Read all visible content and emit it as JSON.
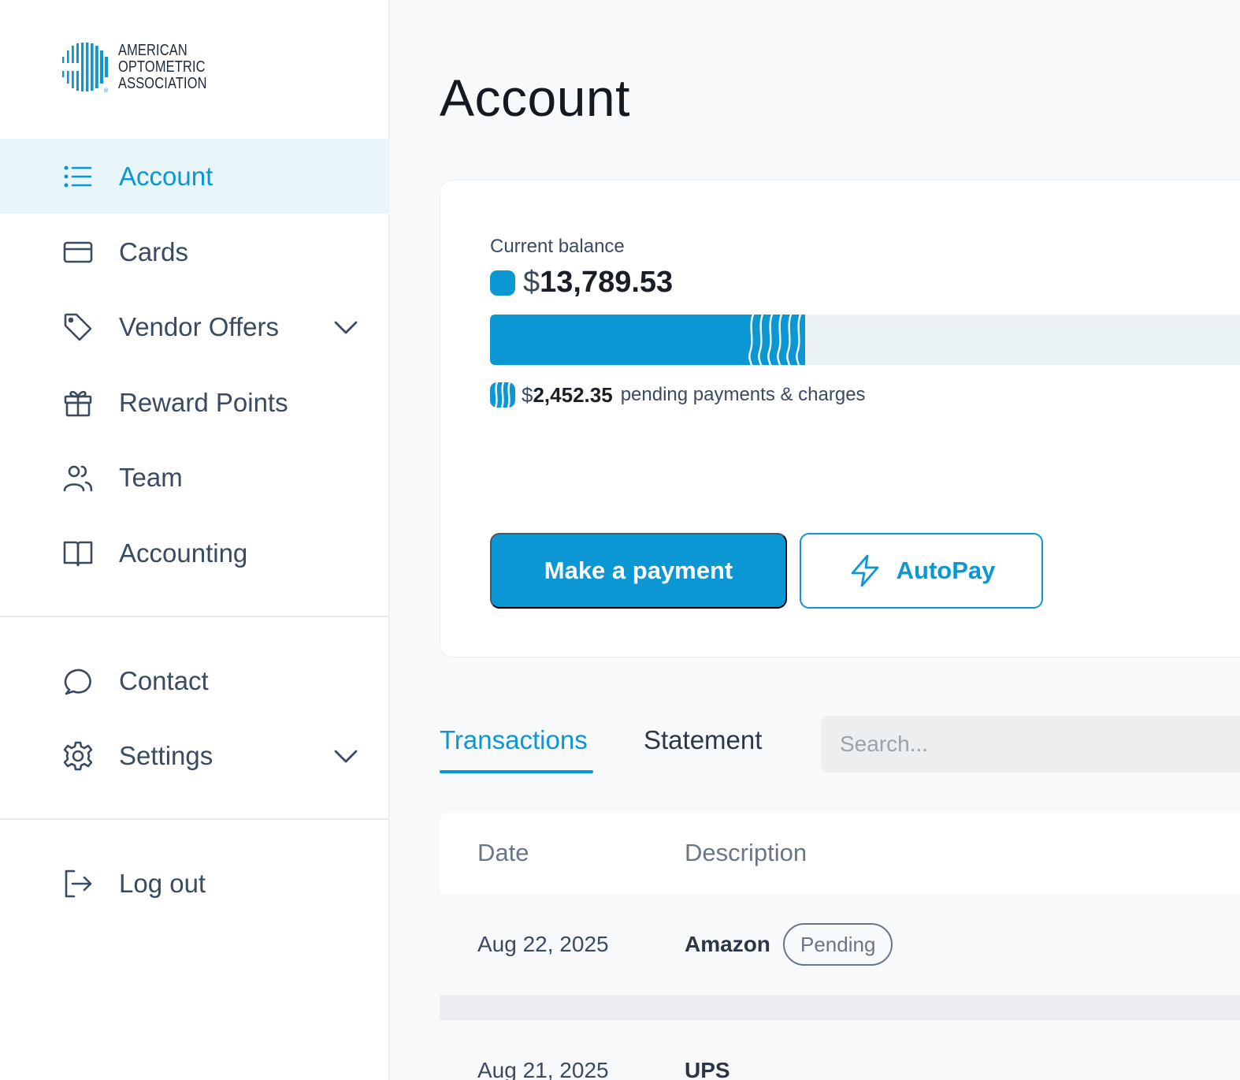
{
  "brand": {
    "logo_line1": "AMERICAN",
    "logo_line2": "OPTOMETRIC",
    "logo_line3": "ASSOCIATION",
    "accent": "#0b97d3"
  },
  "sidebar": {
    "items": [
      {
        "label": "Account",
        "icon": "list-icon",
        "active": true
      },
      {
        "label": "Cards",
        "icon": "credit-card-icon"
      },
      {
        "label": "Vendor Offers",
        "icon": "tag-icon",
        "expandable": true
      },
      {
        "label": "Reward Points",
        "icon": "gift-icon"
      },
      {
        "label": "Team",
        "icon": "users-icon"
      },
      {
        "label": "Accounting",
        "icon": "book-icon"
      }
    ],
    "secondary": [
      {
        "label": "Contact",
        "icon": "chat-bubble-icon"
      },
      {
        "label": "Settings",
        "icon": "gear-icon",
        "expandable": true
      }
    ],
    "logout": {
      "label": "Log out",
      "icon": "logout-icon"
    }
  },
  "page": {
    "title": "Account"
  },
  "balance": {
    "label": "Current balance",
    "currency": "$",
    "amount": "13,789.53",
    "pending_currency": "$",
    "pending_amount": "2,452.35",
    "pending_label": "pending payments & charges",
    "posted_fraction": 0.333,
    "pending_fraction": 0.075
  },
  "actions": {
    "make_payment": "Make a payment",
    "autopay": "AutoPay"
  },
  "tabs": {
    "transactions": "Transactions",
    "statement": "Statement",
    "search_placeholder": "Search..."
  },
  "table": {
    "headers": {
      "date": "Date",
      "description": "Description"
    },
    "rows": [
      {
        "date": "Aug 22, 2025",
        "description": "Amazon",
        "status": "Pending"
      },
      {
        "date": "Aug 21, 2025",
        "description": "UPS",
        "status": ""
      }
    ]
  }
}
